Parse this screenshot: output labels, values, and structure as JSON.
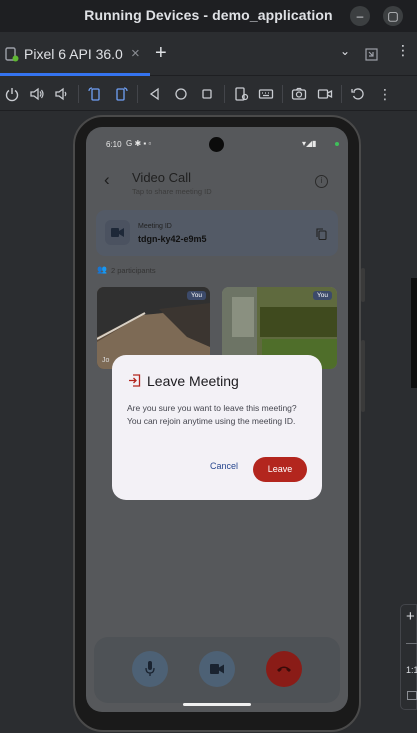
{
  "window": {
    "title": "Running Devices - demo_application"
  },
  "tabs": [
    {
      "label": "Pixel 6 API 36.0"
    }
  ],
  "device": {
    "status": {
      "time": "6:10"
    },
    "header": {
      "title": "Video Call",
      "subtitle": "Tap to share meeting ID"
    },
    "meeting_card": {
      "label": "Meeting ID",
      "id": "tdgn-ky42-e9m5"
    },
    "participants_text": "2 participants",
    "tiles": [
      {
        "badge": "You",
        "name_partial": "Jo"
      },
      {
        "badge": "You"
      }
    ]
  },
  "dialog": {
    "title": "Leave Meeting",
    "message": "Are you sure you want to leave this meeting? You can rejoin anytime using the meeting ID.",
    "cancel_label": "Cancel",
    "confirm_label": "Leave"
  },
  "right_panel": {
    "ratio": "1:1"
  },
  "colors": {
    "accent": "#3574f0",
    "leave": "#b3261e",
    "cancel": "#27468e",
    "end_call": "#8a1c17"
  }
}
